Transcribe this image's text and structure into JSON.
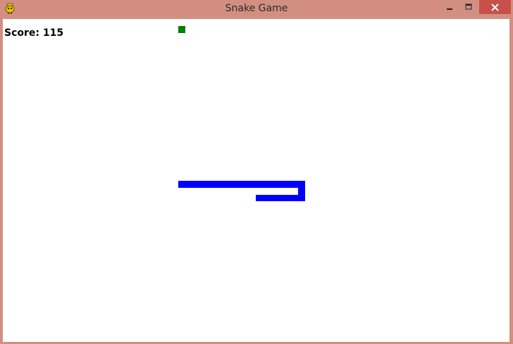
{
  "window": {
    "title": "Snake Game"
  },
  "hud": {
    "score_label": "Score: 115"
  },
  "colors": {
    "snake": "#0000ff",
    "food": "#008000",
    "background": "#ffffff",
    "titlebar": "#d28f81",
    "close_button": "#c7504a"
  }
}
